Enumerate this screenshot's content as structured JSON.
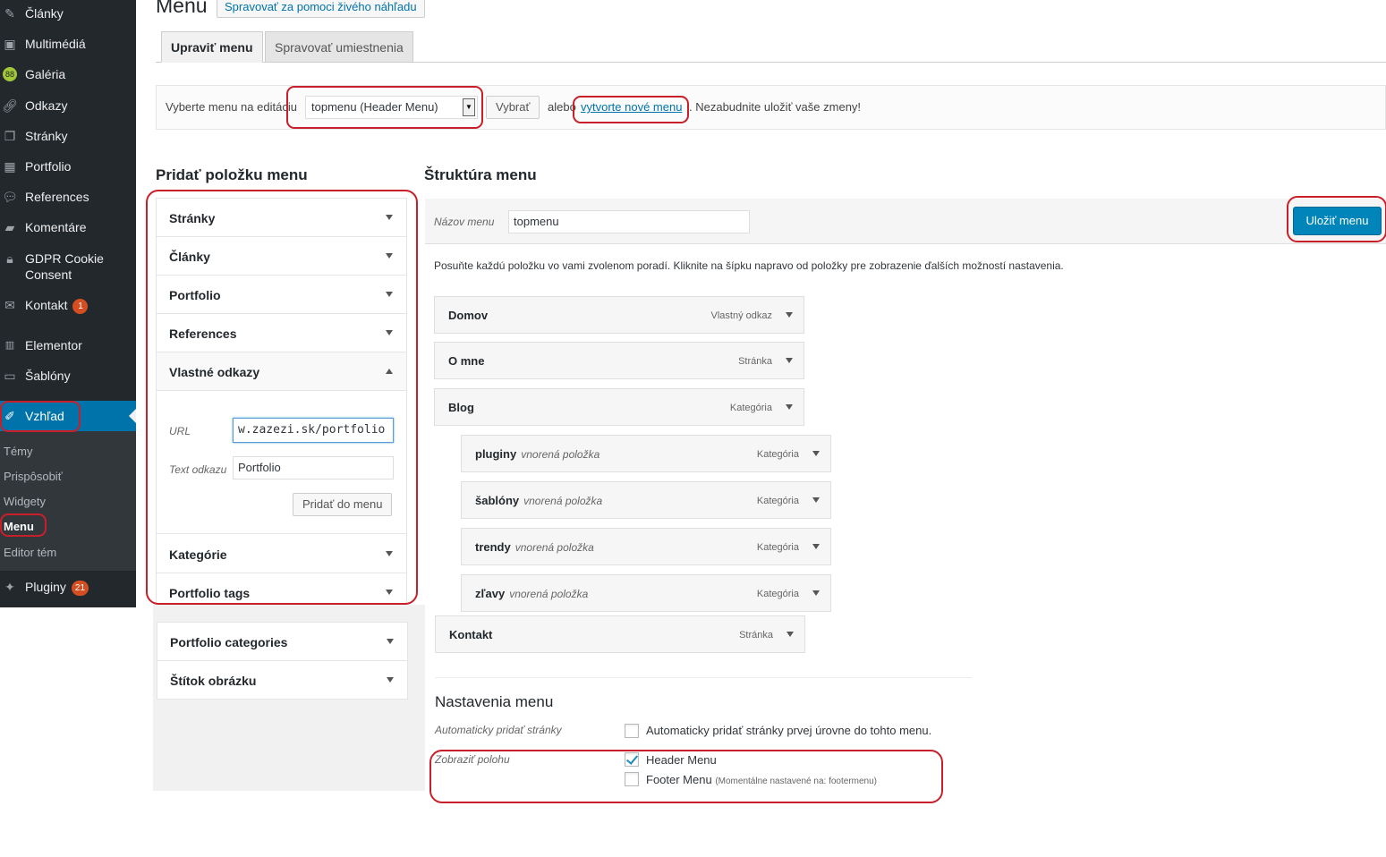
{
  "sidebar": {
    "items": [
      {
        "label": "Články",
        "icon": "pin-icon"
      },
      {
        "label": "Multimédiá",
        "icon": "media-icon"
      },
      {
        "label": "Galéria",
        "icon": "gallery-icon"
      },
      {
        "label": "Odkazy",
        "icon": "link-icon"
      },
      {
        "label": "Stránky",
        "icon": "pages-icon"
      },
      {
        "label": "Portfolio",
        "icon": "grid-icon"
      },
      {
        "label": "References",
        "icon": "speech-bubbles-icon"
      },
      {
        "label": "Komentáre",
        "icon": "comment-icon"
      },
      {
        "label_line1": "GDPR Cookie",
        "label_line2": "Consent",
        "icon": "lock-icon"
      },
      {
        "label": "Kontakt",
        "badge": "1",
        "icon": "mail-icon"
      },
      {
        "label": "Elementor",
        "icon": "elementor-icon"
      },
      {
        "label": "Šablóny",
        "icon": "folder-icon"
      },
      {
        "label": "Vzhľad",
        "icon": "brush-icon"
      },
      {
        "label": "Pluginy",
        "badge": "21",
        "icon": "plugin-icon"
      }
    ],
    "submenu": [
      "Témy",
      "Prispôsobiť",
      "Widgety",
      "Menu",
      "Editor tém"
    ]
  },
  "header": {
    "title": "Menu",
    "live_preview": "Spravovať za pomoci živého náhľadu",
    "tabs": [
      "Upraviť menu",
      "Spravovať umiestnenia"
    ]
  },
  "manage": {
    "select_label": "Vyberte menu na editáciu",
    "selected_menu": "topmenu (Header Menu)",
    "select_button": "Vybrať",
    "or": "alebo",
    "create_link": "vytvorte nové menu",
    "reminder": ". Nezabudnite uložiť vaše zmeny!"
  },
  "add_items": {
    "heading": "Pridať položku menu",
    "sections": [
      "Stránky",
      "Články",
      "Portfolio",
      "References",
      "Vlastné odkazy",
      "Kategórie",
      "Portfolio tags",
      "Portfolio categories",
      "Štítok obrázku"
    ],
    "custom": {
      "url_label": "URL",
      "url_value": "w.zazezi.sk/portfolio",
      "text_label": "Text odkazu",
      "text_value": "Portfolio",
      "add_button": "Pridať do menu"
    }
  },
  "structure": {
    "heading": "Štruktúra menu",
    "name_label": "Názov menu",
    "name_value": "topmenu",
    "save_button": "Uložiť menu",
    "instructions": "Posuňte každú položku vo vami zvolenom poradí. Kliknite na šípku napravo od položky pre zobrazenie ďalších možností nastavenia.",
    "items": [
      {
        "title": "Domov",
        "type": "Vlastný odkaz"
      },
      {
        "title": "O mne",
        "type": "Stránka"
      },
      {
        "title": "Blog",
        "type": "Kategória"
      },
      {
        "title": "pluginy",
        "sub": "vnorená položka",
        "type": "Kategória"
      },
      {
        "title": "šablóny",
        "sub": "vnorená položka",
        "type": "Kategória"
      },
      {
        "title": "trendy",
        "sub": "vnorená položka",
        "type": "Kategória"
      },
      {
        "title": "zľavy",
        "sub": "vnorená položka",
        "type": "Kategória"
      },
      {
        "title": "Kontakt",
        "type": "Stránka"
      }
    ]
  },
  "settings": {
    "heading": "Nastavenia menu",
    "auto_add_label": "Automaticky pridať stránky",
    "auto_add_text": "Automaticky pridať stránky prvej úrovne do tohto menu.",
    "location_label": "Zobraziť polohu",
    "locations": [
      {
        "name": "Header Menu",
        "checked": true,
        "note": ""
      },
      {
        "name": "Footer Menu",
        "checked": false,
        "note": "(Momentálne nastavené na: footermenu)"
      }
    ]
  },
  "colors": {
    "sidebar": "#23282d",
    "accent": "#0073aa",
    "primary_button": "#0085ba",
    "annotation": "#c8202a"
  }
}
